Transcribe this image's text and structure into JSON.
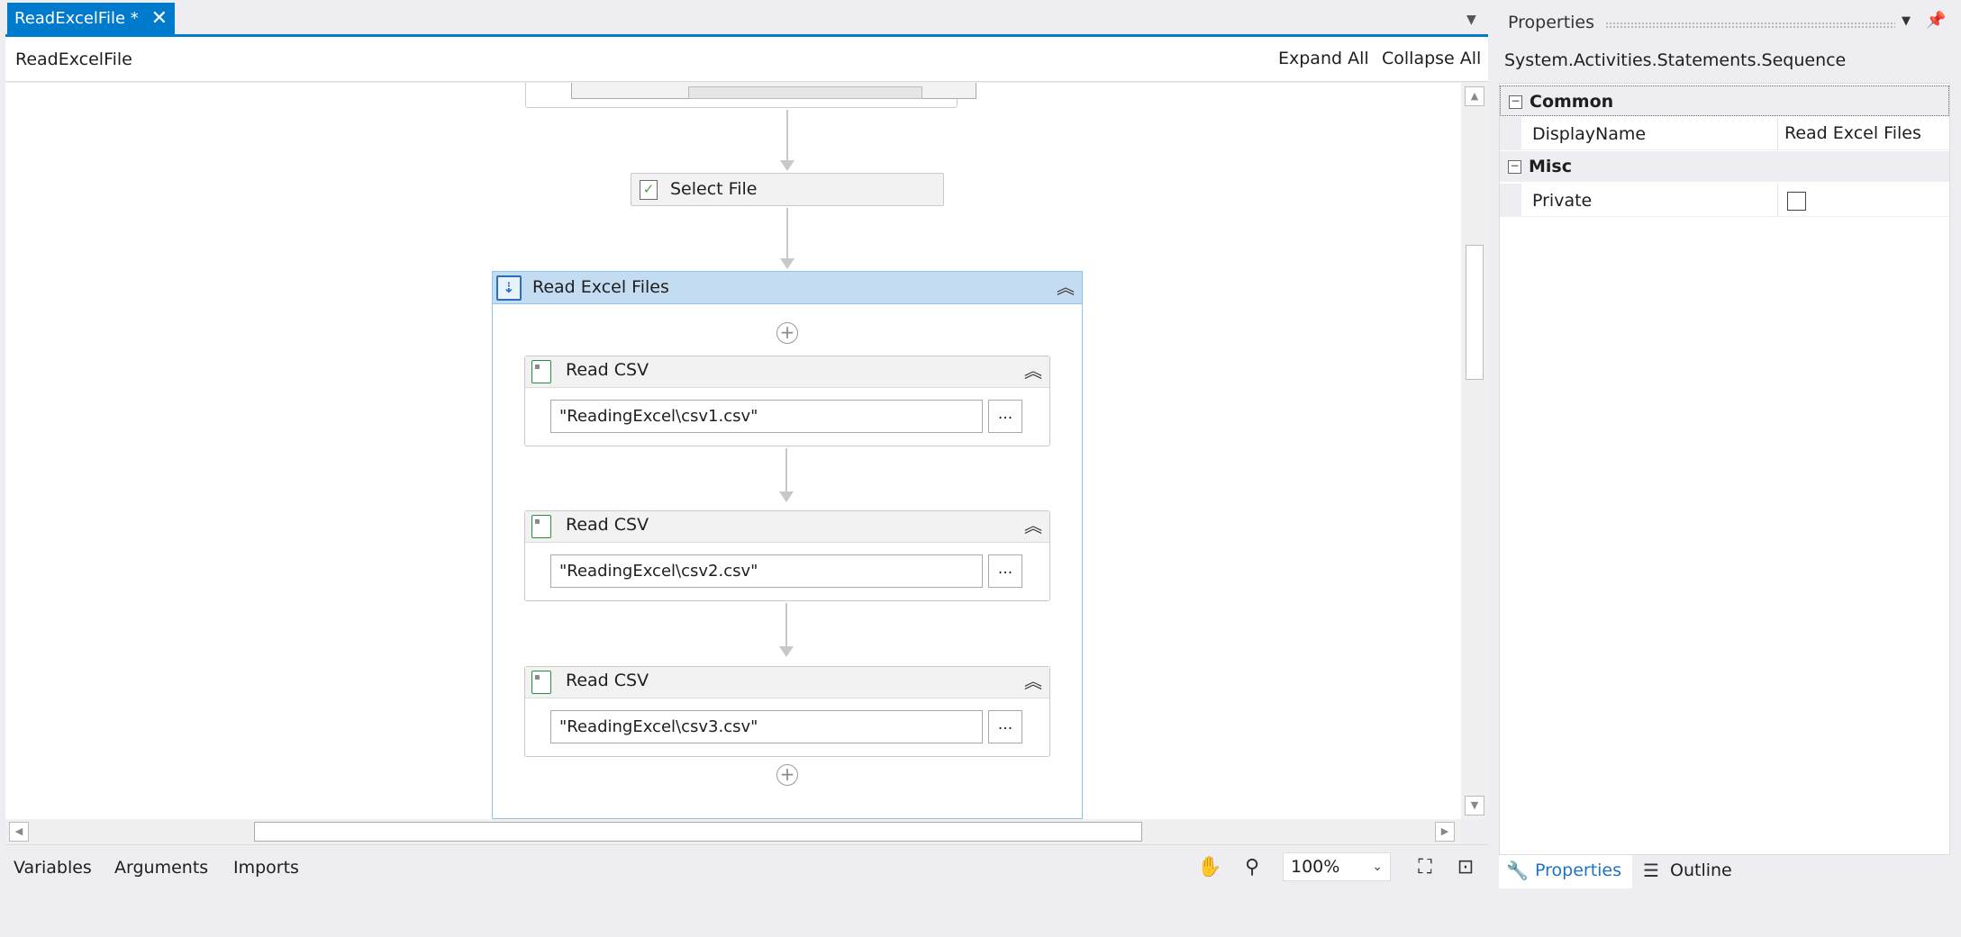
{
  "document_tab": {
    "title": "ReadExcelFile *",
    "close": "✕"
  },
  "breadcrumb": "ReadExcelFile",
  "toolbar": {
    "expand_all": "Expand All",
    "collapse_all": "Collapse All"
  },
  "workflow": {
    "select_file": {
      "label": "Select File",
      "icon": "checklist-icon"
    },
    "sequence": {
      "label": "Read Excel Files",
      "icon": "sequence-icon",
      "activities": [
        {
          "label": "Read CSV",
          "path": "\"ReadingExcel\\csv1.csv\"",
          "browse": "..."
        },
        {
          "label": "Read CSV",
          "path": "\"ReadingExcel\\csv2.csv\"",
          "browse": "..."
        },
        {
          "label": "Read CSV",
          "path": "\"ReadingExcel\\csv3.csv\"",
          "browse": "..."
        }
      ]
    }
  },
  "bottom_tabs": {
    "variables": "Variables",
    "arguments": "Arguments",
    "imports": "Imports"
  },
  "zoom": {
    "level": "100%"
  },
  "properties": {
    "title": "Properties",
    "type_name": "System.Activities.Statements.Sequence",
    "categories": {
      "common": {
        "label": "Common",
        "toggle": "−"
      },
      "misc": {
        "label": "Misc",
        "toggle": "−"
      }
    },
    "rows": {
      "display_name": {
        "name": "DisplayName",
        "value": "Read Excel Files"
      },
      "private": {
        "name": "Private",
        "checked": false
      }
    },
    "tabs": {
      "properties": "Properties",
      "outline": "Outline"
    }
  },
  "colors": {
    "accent": "#007acc",
    "sequence_header": "#c3dcf1",
    "sequence_border": "#8fc3e8",
    "link_tab": "#1e73c4"
  }
}
